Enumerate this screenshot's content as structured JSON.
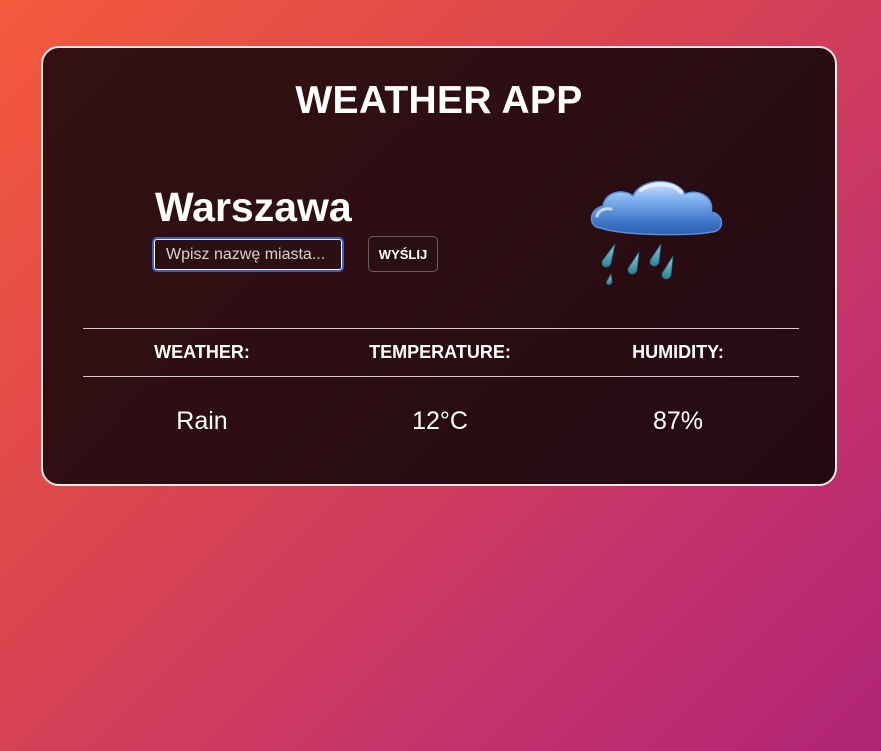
{
  "app": {
    "title": "WEATHER APP"
  },
  "location": {
    "city": "Warszawa"
  },
  "search": {
    "placeholder": "Wpisz nazwę miasta...",
    "value": "",
    "submit_label": "WYŚLIJ"
  },
  "current": {
    "icon": "cloud-with-rain-icon",
    "weather_label": "WEATHER:",
    "temperature_label": "TEMPERATURE:",
    "humidity_label": "HUMIDITY:",
    "weather": "Rain",
    "temperature": "12°C",
    "humidity": "87%"
  },
  "colors": {
    "background_start": "#f35a3c",
    "background_end": "#b02476",
    "card_background": "#2c0e12",
    "card_border": "#f1e6ea",
    "input_focus": "#3a5bdc",
    "text": "#ffffff"
  }
}
